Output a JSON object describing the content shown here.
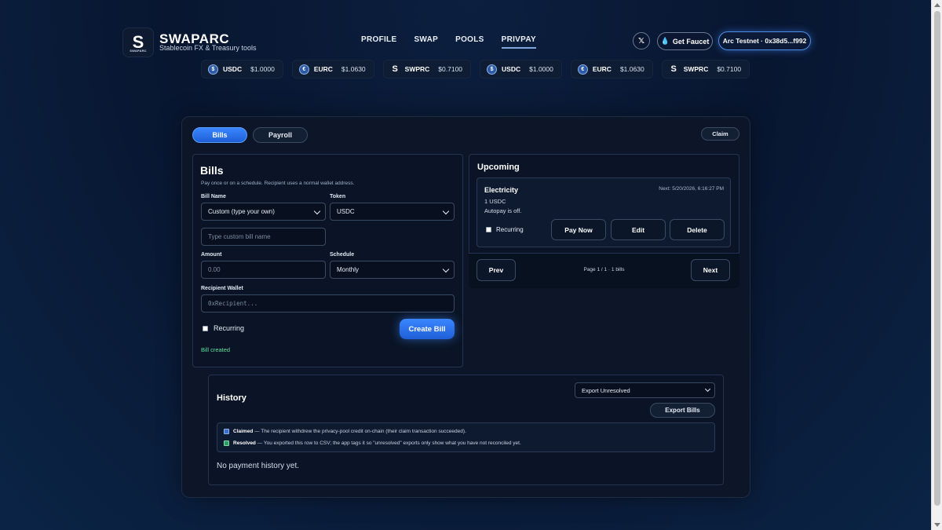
{
  "brand": {
    "logo_letter": "S",
    "logo_mini": "SWAPARC",
    "title": "SWAPARC",
    "subtitle": "Stablecoin FX & Treasury tools"
  },
  "nav": {
    "items": [
      {
        "label": "PROFILE"
      },
      {
        "label": "SWAP"
      },
      {
        "label": "POOLS"
      },
      {
        "label": "PRIVPAY",
        "active": true
      }
    ]
  },
  "header": {
    "x_label": "𝕏",
    "faucet_label": "Get Faucet",
    "faucet_icon": "droplet-icon",
    "wallet_label": "Arc Testnet · 0x38d5...f992"
  },
  "ticker": [
    {
      "symbol": "USDC",
      "price": "$1.0000",
      "icon": "usdc-coin-icon"
    },
    {
      "symbol": "EURC",
      "price": "$1.0630",
      "icon": "eurc-coin-icon"
    },
    {
      "symbol": "SWPRC",
      "price": "$0.7100",
      "icon": "swprc-coin-icon"
    },
    {
      "symbol": "USDC",
      "price": "$1.0000",
      "icon": "usdc-coin-icon"
    },
    {
      "symbol": "EURC",
      "price": "$1.0630",
      "icon": "eurc-coin-icon"
    },
    {
      "symbol": "SWPRC",
      "price": "$0.7100",
      "icon": "swprc-coin-icon"
    }
  ],
  "tabs": {
    "bills": "Bills",
    "payroll": "Payroll",
    "claim": "Claim"
  },
  "bills_form": {
    "title": "Bills",
    "description": "Pay once or on a schedule. Recipient uses a normal wallet address.",
    "bill_name_label": "Bill Name",
    "bill_name_value": "Custom (type your own)",
    "token_label": "Token",
    "token_value": "USDC",
    "custom_name_placeholder": "Type custom bill name",
    "amount_label": "Amount",
    "amount_placeholder": "0.00",
    "schedule_label": "Schedule",
    "schedule_value": "Monthly",
    "recipient_label": "Recipient Wallet",
    "recipient_placeholder": "0xRecipient...",
    "recurring_label": "Recurring",
    "create_button": "Create Bill",
    "status": "Bill created"
  },
  "upcoming": {
    "title": "Upcoming",
    "bill": {
      "name": "Electricity",
      "next": "Next: 5/20/2026, 6:16:27 PM",
      "amount": "1 USDC",
      "autopay": "Autopay is off.",
      "recurring_label": "Recurring",
      "pay_now": "Pay Now",
      "edit": "Edit",
      "delete": "Delete"
    },
    "pager": {
      "prev": "Prev",
      "info": "Page 1 / 1 · 1 bills",
      "next": "Next"
    }
  },
  "history": {
    "title": "History",
    "filter_value": "Export Unresolved",
    "export_button": "Export Bills",
    "legend": [
      {
        "term": "Claimed",
        "text": " — The recipient withdrew the privacy-pool credit on-chain (their claim transaction succeeded).",
        "color": "#3a6fc9"
      },
      {
        "term": "Resolved",
        "text": " — You exported this row to CSV; the app tags it so \"unresolved\" exports only show what you have not reconciled yet.",
        "color": "#2f9b63"
      }
    ],
    "empty": "No payment history yet."
  }
}
